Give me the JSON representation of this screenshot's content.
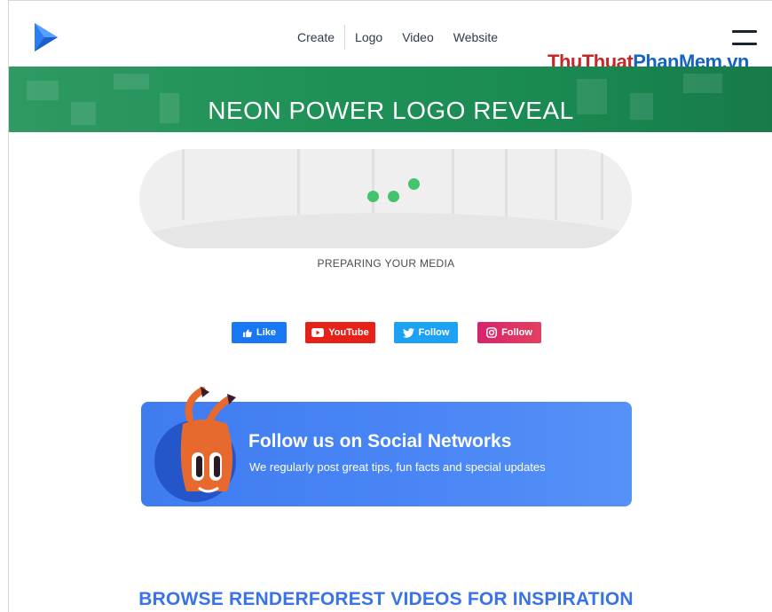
{
  "header": {
    "nav": [
      "Create",
      "Logo",
      "Video",
      "Website"
    ]
  },
  "watermark": {
    "part1": "ThuThuat",
    "part2": "PhanMem",
    "part3": ".vn"
  },
  "banner": {
    "title": "NEON POWER LOGO REVEAL"
  },
  "loader": {
    "status": "PREPARING YOUR MEDIA"
  },
  "social": {
    "facebook": "Like",
    "youtube": "YouTube",
    "twitter": "Follow",
    "instagram": "Follow"
  },
  "follow_card": {
    "title": "Follow us on Social Networks",
    "subtitle": "We regularly post great tips, fun facts and special updates"
  },
  "browse": {
    "heading": "BROWSE RENDERFOREST VIDEOS FOR INSPIRATION"
  },
  "colors": {
    "accent": "#3a72e8",
    "banner_green": "#1f9157",
    "loader_dot": "#41c46b",
    "card_blue": "#4a86f5"
  },
  "icons": [
    "renderforest-logo-icon",
    "hamburger-menu-icon",
    "thumbs-up-icon",
    "youtube-play-icon",
    "twitter-bird-icon",
    "instagram-icon"
  ]
}
